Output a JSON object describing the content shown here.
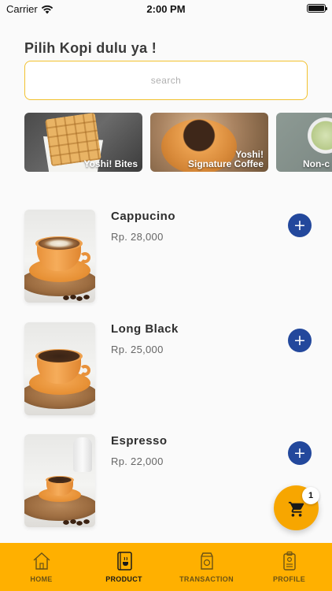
{
  "status_bar": {
    "carrier": "Carrier",
    "time": "2:00 PM"
  },
  "header": {
    "title": "Pilih Kopi dulu ya !"
  },
  "search": {
    "placeholder": "search",
    "value": ""
  },
  "categories": [
    {
      "label_line1": "Yoshi! Bites",
      "label_line2": ""
    },
    {
      "label_line1": "Yoshi!",
      "label_line2": "Signature Coffee"
    },
    {
      "label_line1": "Non-c",
      "label_line2": ""
    }
  ],
  "products": [
    {
      "name": "Cappucino",
      "price": "Rp. 28,000",
      "add_label": "+"
    },
    {
      "name": "Long Black",
      "price": "Rp. 25,000",
      "add_label": "+"
    },
    {
      "name": "Espresso",
      "price": "Rp. 22,000",
      "add_label": "+"
    }
  ],
  "cart": {
    "count": "1",
    "icon": "cart-icon"
  },
  "nav": [
    {
      "label": "HOME",
      "icon": "home-icon",
      "active": false
    },
    {
      "label": "PRODUCT",
      "icon": "menu-book-icon",
      "active": true
    },
    {
      "label": "TRANSACTION",
      "icon": "bag-icon",
      "active": false
    },
    {
      "label": "PROFILE",
      "icon": "id-card-icon",
      "active": false
    }
  ],
  "colors": {
    "accent": "#ffb000",
    "search_border": "#f2c12e",
    "add_button": "#23489c",
    "cart_fab": "#f7a600"
  }
}
